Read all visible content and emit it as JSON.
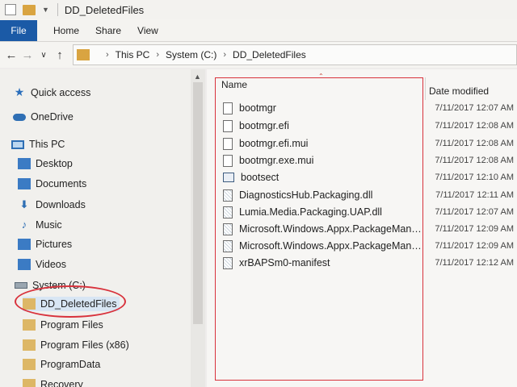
{
  "window": {
    "title": "DD_DeletedFiles"
  },
  "ribbon": {
    "tabs": [
      "File",
      "Home",
      "Share",
      "View"
    ]
  },
  "address_bar": {
    "path": [
      "This PC",
      "System (C:)",
      "DD_DeletedFiles"
    ]
  },
  "nav_pane": {
    "items": [
      {
        "label": "Quick access",
        "icon": "star-icon"
      },
      {
        "label": "OneDrive",
        "icon": "cloud-icon"
      },
      {
        "label": "This PC",
        "icon": "computer-icon"
      },
      {
        "label": "Desktop",
        "icon": "desktop-folder-icon"
      },
      {
        "label": "Documents",
        "icon": "documents-folder-icon"
      },
      {
        "label": "Downloads",
        "icon": "download-arrow-icon"
      },
      {
        "label": "Music",
        "icon": "music-note-icon"
      },
      {
        "label": "Pictures",
        "icon": "pictures-folder-icon"
      },
      {
        "label": "Videos",
        "icon": "videos-folder-icon"
      },
      {
        "label": "System (C:)",
        "icon": "drive-icon"
      },
      {
        "label": "DD_DeletedFiles",
        "icon": "folder-icon"
      },
      {
        "label": "Program Files",
        "icon": "folder-icon"
      },
      {
        "label": "Program Files (x86)",
        "icon": "folder-icon"
      },
      {
        "label": "ProgramData",
        "icon": "folder-icon"
      },
      {
        "label": "Recovery",
        "icon": "folder-icon"
      }
    ],
    "selected": "DD_DeletedFiles"
  },
  "file_list": {
    "columns": [
      "Name",
      "Date modified"
    ],
    "rows": [
      {
        "name": "bootmgr",
        "date": "7/11/2017 12:07 AM"
      },
      {
        "name": "bootmgr.efi",
        "date": "7/11/2017 12:08 AM"
      },
      {
        "name": "bootmgr.efi.mui",
        "date": "7/11/2017 12:08 AM"
      },
      {
        "name": "bootmgr.exe.mui",
        "date": "7/11/2017 12:08 AM"
      },
      {
        "name": "bootsect",
        "date": "7/11/2017 12:10 AM"
      },
      {
        "name": "DiagnosticsHub.Packaging.dll",
        "date": "7/11/2017 12:11 AM"
      },
      {
        "name": "Lumia.Media.Packaging.UAP.dll",
        "date": "7/11/2017 12:07 AM"
      },
      {
        "name": "Microsoft.Windows.Appx.PackageManag...",
        "date": "7/11/2017 12:09 AM"
      },
      {
        "name": "Microsoft.Windows.Appx.PackageManag...",
        "date": "7/11/2017 12:09 AM"
      },
      {
        "name": "xrBAPSm0-manifest",
        "date": "7/11/2017 12:12 AM"
      }
    ]
  },
  "colors": {
    "accent": "#1b5aa6",
    "annotation": "#d8323c",
    "folder": "#ddb766"
  }
}
